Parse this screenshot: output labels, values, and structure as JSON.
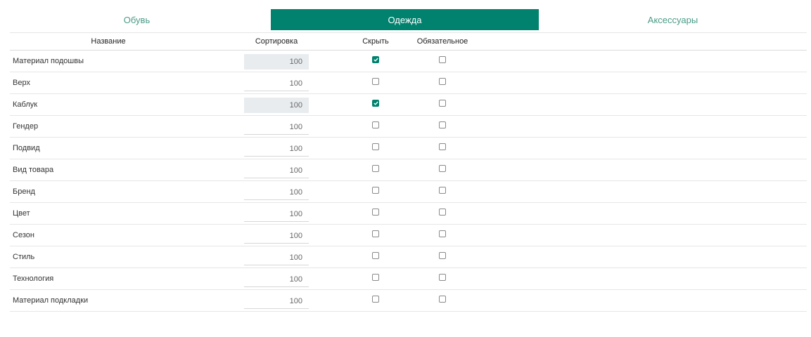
{
  "tabs": [
    {
      "label": "Обувь",
      "active": false
    },
    {
      "label": "Одежда",
      "active": true
    },
    {
      "label": "Аксессуары",
      "active": false
    }
  ],
  "columns": {
    "name": "Название",
    "sort": "Сортировка",
    "hide": "Скрыть",
    "required": "Обязательное"
  },
  "rows": [
    {
      "name": "Материал подошвы",
      "sort": "100",
      "hidden": true,
      "required": false
    },
    {
      "name": "Верх",
      "sort": "100",
      "hidden": false,
      "required": false
    },
    {
      "name": "Каблук",
      "sort": "100",
      "hidden": true,
      "required": false
    },
    {
      "name": "Гендер",
      "sort": "100",
      "hidden": false,
      "required": false
    },
    {
      "name": "Подвид",
      "sort": "100",
      "hidden": false,
      "required": false
    },
    {
      "name": "Вид товара",
      "sort": "100",
      "hidden": false,
      "required": false
    },
    {
      "name": "Бренд",
      "sort": "100",
      "hidden": false,
      "required": false
    },
    {
      "name": "Цвет",
      "sort": "100",
      "hidden": false,
      "required": false
    },
    {
      "name": "Сезон",
      "sort": "100",
      "hidden": false,
      "required": false
    },
    {
      "name": "Стиль",
      "sort": "100",
      "hidden": false,
      "required": false
    },
    {
      "name": "Технология",
      "sort": "100",
      "hidden": false,
      "required": false
    },
    {
      "name": "Материал подкладки",
      "sort": "100",
      "hidden": false,
      "required": false
    }
  ],
  "colors": {
    "accent": "#00826e",
    "tab_text": "#4a9b87",
    "disabled_input": "#e9ecef"
  },
  "icons": {
    "checkbox_checked": "check-icon"
  }
}
